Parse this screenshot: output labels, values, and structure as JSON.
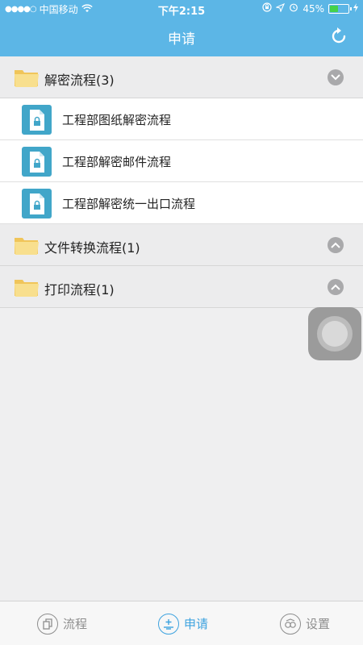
{
  "status_bar": {
    "signal": "●●●●○",
    "carrier": "中国移动",
    "wifi": "wifi-icon",
    "time": "下午2:15",
    "battery_percent": "45%",
    "battery_level": 0.45
  },
  "header": {
    "title": "申请",
    "refresh_icon": "refresh-icon"
  },
  "groups": [
    {
      "label": "解密流程(3)",
      "expanded": true,
      "items": [
        {
          "label": "工程部图纸解密流程"
        },
        {
          "label": "工程部解密邮件流程"
        },
        {
          "label": "工程部解密统一出口流程"
        }
      ]
    },
    {
      "label": "文件转换流程(1)",
      "expanded": false
    },
    {
      "label": "打印流程(1)",
      "expanded": false
    }
  ],
  "tabbar": {
    "tabs": [
      {
        "label": "流程",
        "icon": "process-icon",
        "active": false
      },
      {
        "label": "申请",
        "icon": "apply-icon",
        "active": true
      },
      {
        "label": "设置",
        "icon": "settings-icon",
        "active": false
      }
    ]
  },
  "colors": {
    "header_bg": "#5cb6e6",
    "accent": "#3ea3df",
    "item_icon_bg": "#41a6c9",
    "folder": "#f5d77a"
  }
}
